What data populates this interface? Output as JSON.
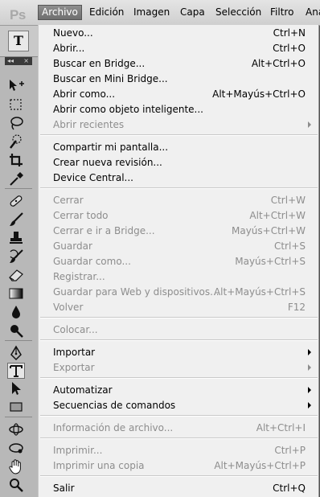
{
  "app": {
    "logo": "Ps"
  },
  "menubar": [
    {
      "label": "Archivo",
      "active": true
    },
    {
      "label": "Edición"
    },
    {
      "label": "Imagen"
    },
    {
      "label": "Capa"
    },
    {
      "label": "Selección"
    },
    {
      "label": "Filtro"
    },
    {
      "label": "Ana"
    }
  ],
  "options_bar": {
    "tool_glyph": "T"
  },
  "toolbox": {
    "collapse": "◂◂",
    "close": "×"
  },
  "menu": {
    "nuevo": {
      "label": "Nuevo...",
      "shortcut": "Ctrl+N"
    },
    "abrir": {
      "label": "Abrir...",
      "shortcut": "Ctrl+O"
    },
    "buscar_bridge": {
      "label": "Buscar en Bridge...",
      "shortcut": "Alt+Ctrl+O"
    },
    "buscar_mini_bridge": {
      "label": "Buscar en Mini Bridge...",
      "shortcut": ""
    },
    "abrir_como": {
      "label": "Abrir como...",
      "shortcut": "Alt+Mayús+Ctrl+O"
    },
    "abrir_objeto": {
      "label": "Abrir como objeto inteligente...",
      "shortcut": ""
    },
    "abrir_recientes": {
      "label": "Abrir recientes",
      "shortcut": ""
    },
    "compartir": {
      "label": "Compartir mi pantalla...",
      "shortcut": ""
    },
    "crear_revision": {
      "label": "Crear nueva revisión...",
      "shortcut": ""
    },
    "device_central": {
      "label": "Device Central...",
      "shortcut": ""
    },
    "cerrar": {
      "label": "Cerrar",
      "shortcut": "Ctrl+W"
    },
    "cerrar_todo": {
      "label": "Cerrar todo",
      "shortcut": "Alt+Ctrl+W"
    },
    "cerrar_bridge": {
      "label": "Cerrar e ir a Bridge...",
      "shortcut": "Mayús+Ctrl+W"
    },
    "guardar": {
      "label": "Guardar",
      "shortcut": "Ctrl+S"
    },
    "guardar_como": {
      "label": "Guardar como...",
      "shortcut": "Mayús+Ctrl+S"
    },
    "registrar": {
      "label": "Registrar...",
      "shortcut": ""
    },
    "guardar_web": {
      "label": "Guardar para Web y dispositivos...",
      "shortcut": "Alt+Mayús+Ctrl+S"
    },
    "volver": {
      "label": "Volver",
      "shortcut": "F12"
    },
    "colocar": {
      "label": "Colocar...",
      "shortcut": ""
    },
    "importar": {
      "label": "Importar",
      "shortcut": ""
    },
    "exportar": {
      "label": "Exportar",
      "shortcut": ""
    },
    "automatizar": {
      "label": "Automatizar",
      "shortcut": ""
    },
    "secuencias": {
      "label": "Secuencias de comandos",
      "shortcut": ""
    },
    "info_archivo": {
      "label": "Información de archivo...",
      "shortcut": "Alt+Ctrl+I"
    },
    "imprimir": {
      "label": "Imprimir...",
      "shortcut": "Ctrl+P"
    },
    "imprimir_copia": {
      "label": "Imprimir una copia",
      "shortcut": "Alt+Mayús+Ctrl+P"
    },
    "salir": {
      "label": "Salir",
      "shortcut": "Ctrl+Q"
    }
  }
}
